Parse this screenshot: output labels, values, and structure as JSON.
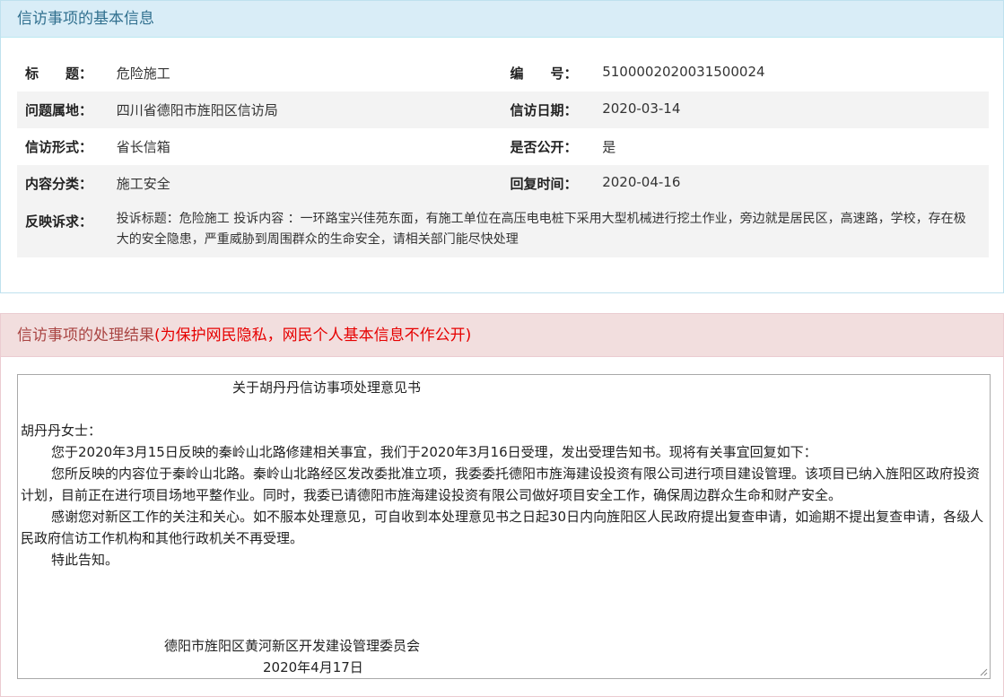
{
  "basic_info": {
    "header": "信访事项的基本信息",
    "rows": [
      {
        "label1": "标　　题：",
        "value1": "危险施工",
        "label2": "编　　号：",
        "value2": "5100002020031500024"
      },
      {
        "label1": "问题属地：",
        "value1": "四川省德阳市旌阳区信访局",
        "label2": "信访日期：",
        "value2": "2020-03-14"
      },
      {
        "label1": "信访形式：",
        "value1": "省长信箱",
        "label2": "是否公开：",
        "value2": "是"
      },
      {
        "label1": "内容分类：",
        "value1": "施工安全",
        "label2": "回复时间：",
        "value2": "2020-04-16"
      }
    ],
    "request_label": "反映诉求：",
    "request_text": "投诉标题：危险施工 投诉内容 ：一环路宝兴佳苑东面，有施工单位在高压电电桩下采用大型机械进行挖土作业，旁边就是居民区，高速路，学校，存在极大的安全隐患，严重威胁到周围群众的生命安全，请相关部门能尽快处理"
  },
  "result": {
    "header": "信访事项的处理结果",
    "header_note": "(为保护网民隐私，网民个人基本信息不作公开)",
    "reply": {
      "title": "关于胡丹丹信访事项处理意见书",
      "salutation": "胡丹丹女士：",
      "paragraphs": [
        "您于2020年3月15日反映的秦岭山北路修建相关事宜，我们于2020年3月16日受理，发出受理告知书。现将有关事宜回复如下：",
        "您所反映的内容位于秦岭山北路。秦岭山北路经区发改委批准立项，我委委托德阳市旌海建设投资有限公司进行项目建设管理。该项目已纳入旌阳区政府投资计划，目前正在进行项目场地平整作业。同时，我委已请德阳市旌海建设投资有限公司做好项目安全工作，确保周边群众生命和财产安全。",
        "感谢您对新区工作的关注和关心。如不服本处理意见，可自收到本处理意见书之日起30日内向旌阳区人民政府提出复查申请，如逾期不提出复查申请，各级人民政府信访工作机构和其他行政机关不再受理。",
        "特此告知。"
      ],
      "signature_org": "德阳市旌阳区黄河新区开发建设管理委员会",
      "signature_date": "2020年4月17日"
    }
  },
  "colors": {
    "info_header_bg": "#d9edf7",
    "info_header_text": "#31708f",
    "result_header_bg": "#f2dede",
    "result_header_text": "#a94442",
    "privacy_note": "#e60000"
  }
}
